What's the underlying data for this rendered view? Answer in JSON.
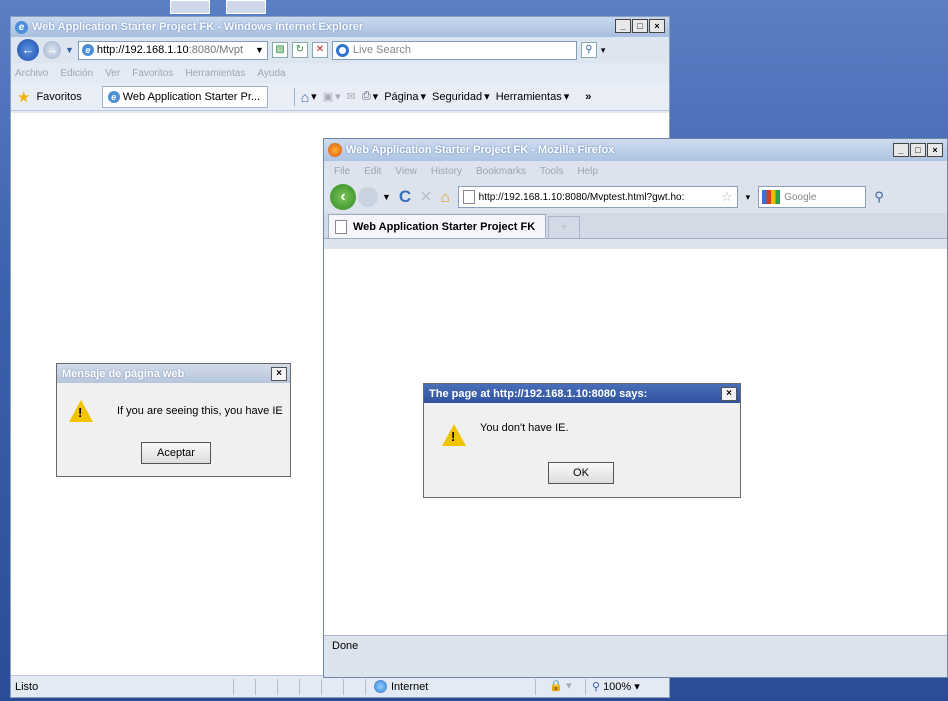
{
  "ie": {
    "title": "Web Application Starter Project FK - Windows Internet Explorer",
    "address_host": "http://192.168.1.10",
    "address_rest": ":8080/Mvpt",
    "search_placeholder": "Live Search",
    "menu": [
      "Archivo",
      "Edición",
      "Ver",
      "Favoritos",
      "Herramientas",
      "Ayuda"
    ],
    "favorites_label": "Favoritos",
    "tab_label": "Web Application Starter Pr...",
    "tools": {
      "page": "Página",
      "security": "Seguridad",
      "tools": "Herramientas"
    },
    "status": "Listo",
    "zone": "Internet",
    "zoom": "100%"
  },
  "ie_dialog": {
    "title": "Mensaje de página web",
    "message": "If you are seeing this, you have IE",
    "button": "Aceptar"
  },
  "ff": {
    "title": "Web Application Starter Project FK - Mozilla Firefox",
    "menu": [
      "File",
      "Edit",
      "View",
      "History",
      "Bookmarks",
      "Tools",
      "Help"
    ],
    "url": "http://192.168.1.10:8080/Mvptest.html?gwt.ho:",
    "search_placeholder": "Google",
    "tab_label": "Web Application Starter Project FK",
    "status": "Done"
  },
  "ff_dialog": {
    "title": "The page at http://192.168.1.10:8080 says:",
    "message": "You don't have IE.",
    "button": "OK"
  },
  "colors": {
    "ie_accent": "#4b8fd8",
    "ff_back": "#2f8a1f",
    "warning": "#f2c400"
  }
}
